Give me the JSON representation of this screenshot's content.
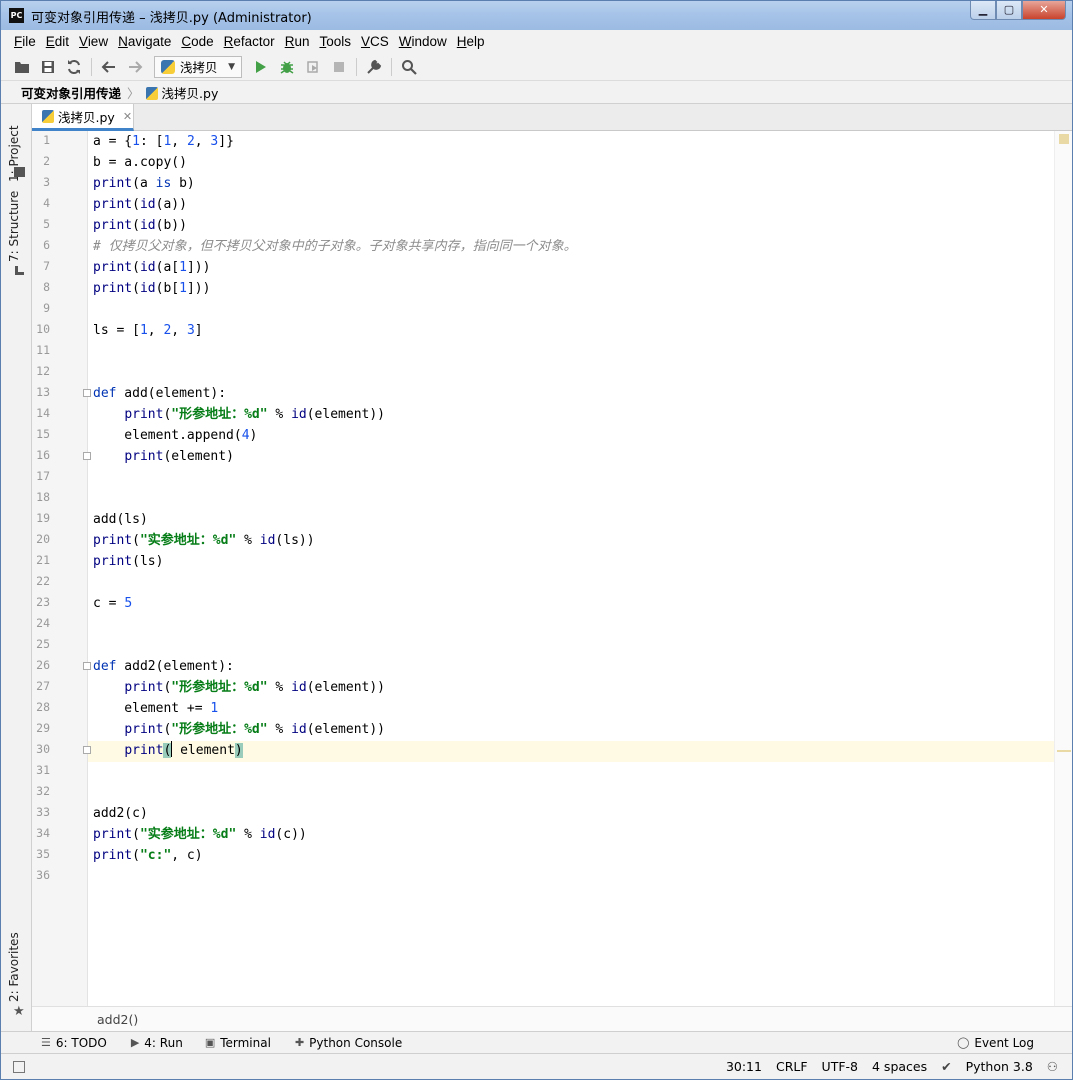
{
  "window": {
    "title": "可变对象引用传递 – 浅拷贝.py (Administrator)",
    "app_badge": "PC",
    "buttons": {
      "minimize": "▁",
      "maximize": "▢",
      "close": "✕"
    }
  },
  "menu": [
    {
      "label": "File",
      "u": "F",
      "rest": "ile"
    },
    {
      "label": "Edit",
      "u": "E",
      "rest": "dit"
    },
    {
      "label": "View",
      "u": "V",
      "rest": "iew"
    },
    {
      "label": "Navigate",
      "u": "N",
      "rest": "avigate"
    },
    {
      "label": "Code",
      "u": "C",
      "rest": "ode"
    },
    {
      "label": "Refactor",
      "u": "R",
      "rest": "efactor"
    },
    {
      "label": "Run",
      "u": "R",
      "rest": "un"
    },
    {
      "label": "Tools",
      "u": "T",
      "rest": "ools"
    },
    {
      "label": "VCS",
      "u": "V",
      "rest": "CS"
    },
    {
      "label": "Window",
      "u": "W",
      "rest": "indow"
    },
    {
      "label": "Help",
      "u": "H",
      "rest": "elp"
    }
  ],
  "toolbar": {
    "run_config": "浅拷贝",
    "icons": [
      "folder-open-icon",
      "save-icon",
      "sync-icon",
      "back-arrow-icon",
      "forward-arrow-icon",
      "run-icon",
      "debug-icon",
      "coverage-icon",
      "stop-icon",
      "wrench-icon",
      "search-icon"
    ]
  },
  "navbar": {
    "project": "可变对象引用传递",
    "file": "浅拷贝.py"
  },
  "left_strip": {
    "project": "1: Project",
    "structure": "7: Structure",
    "favorites": "2: Favorites"
  },
  "editor_tab": {
    "label": "浅拷贝.py",
    "close": "✕"
  },
  "code_lines": [
    "a = {1: [1, 2, 3]}",
    "b = a.copy()",
    "print(a is b)",
    "print(id(a))",
    "print(id(b))",
    "# 仅拷贝父对象，但不拷贝父对象中的子对象。子对象共享内存，指向同一个对象。",
    "print(id(a[1]))",
    "print(id(b[1]))",
    "",
    "ls = [1, 2, 3]",
    "",
    "",
    "def add(element):",
    "    print(\"形参地址：%d\" % id(element))",
    "    element.append(4)",
    "    print(element)",
    "",
    "",
    "add(ls)",
    "print(\"实参地址：%d\" % id(ls))",
    "print(ls)",
    "",
    "c = 5",
    "",
    "",
    "def add2(element):",
    "    print(\"形参地址：%d\" % id(element))",
    "    element += 1",
    "    print(\"形参地址：%d\" % id(element))",
    "    print( element)",
    "",
    "",
    "add2(c)",
    "print(\"实参地址：%d\" % id(c))",
    "print(\"c:\", c)",
    ""
  ],
  "editor_breadcrumb": "add2()",
  "tool_windows": {
    "todo": "6: TODO",
    "run": "4: Run",
    "terminal": "Terminal",
    "python_console": "Python Console",
    "event_log": "Event Log"
  },
  "status": {
    "position": "30:11",
    "line_sep": "CRLF",
    "encoding": "UTF-8",
    "indent": "4 spaces",
    "interpreter": "Python 3.8"
  }
}
